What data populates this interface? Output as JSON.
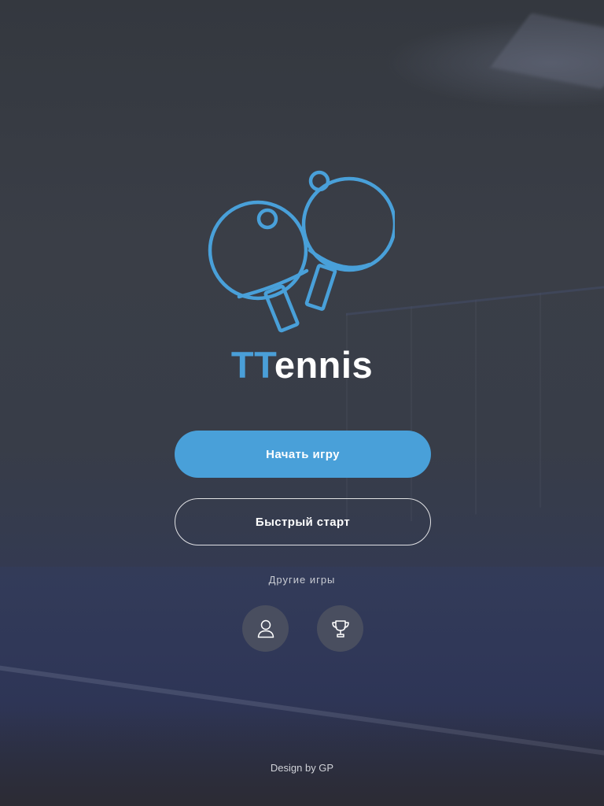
{
  "app": {
    "title_accent": "TT",
    "title_rest": "ennis"
  },
  "menu": {
    "start_game": "Начать игру",
    "quick_start": "Быстрый старт",
    "other_games": "Другие игры"
  },
  "icons": {
    "logo": "paddles-icon",
    "player": "user-icon",
    "trophy": "trophy-icon"
  },
  "footer": {
    "credit": "Design by GP"
  },
  "colors": {
    "accent": "#49a0d9",
    "text": "#ffffff"
  }
}
